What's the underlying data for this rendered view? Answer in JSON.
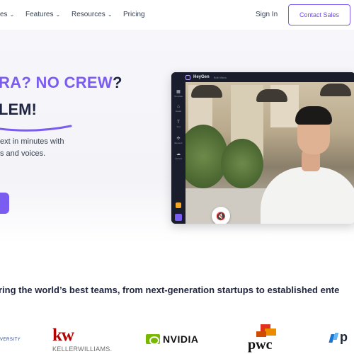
{
  "nav": {
    "items": [
      {
        "label": "es",
        "dropdown": true
      },
      {
        "label": "Features",
        "dropdown": true
      },
      {
        "label": "Resources",
        "dropdown": true
      },
      {
        "label": "Pricing",
        "dropdown": false
      }
    ],
    "signin": "Sign In",
    "contact": "Contact Sales"
  },
  "hero": {
    "line1_a": "RA? NO ",
    "line1_b": "CREW",
    "line1_c": "?",
    "line2": "LEM!",
    "sub1": "ext in minutes with",
    "sub2": "s and voices."
  },
  "app": {
    "brand": "HeyGen",
    "brand_sub": "Edit Video",
    "side": [
      {
        "icon": "▦",
        "label": "Template"
      },
      {
        "icon": "⌂",
        "label": "Avatar"
      },
      {
        "icon": "T",
        "label": "Text"
      },
      {
        "icon": "✣",
        "label": "Element"
      },
      {
        "icon": "☁",
        "label": "Upload"
      }
    ],
    "mute_icon": "🔇"
  },
  "trust": "ring the world’s best teams, from next-generation startups to established ente",
  "logos": {
    "univ": "VERSITY",
    "kw_mark": "kw",
    "kw_text": "KELLERWILLIAMS.",
    "nvidia": "NVIDIA",
    "pwc": "pwc",
    "p": "p"
  },
  "colors": {
    "accent": "#7b5cf0",
    "heading": "#1f2540"
  }
}
